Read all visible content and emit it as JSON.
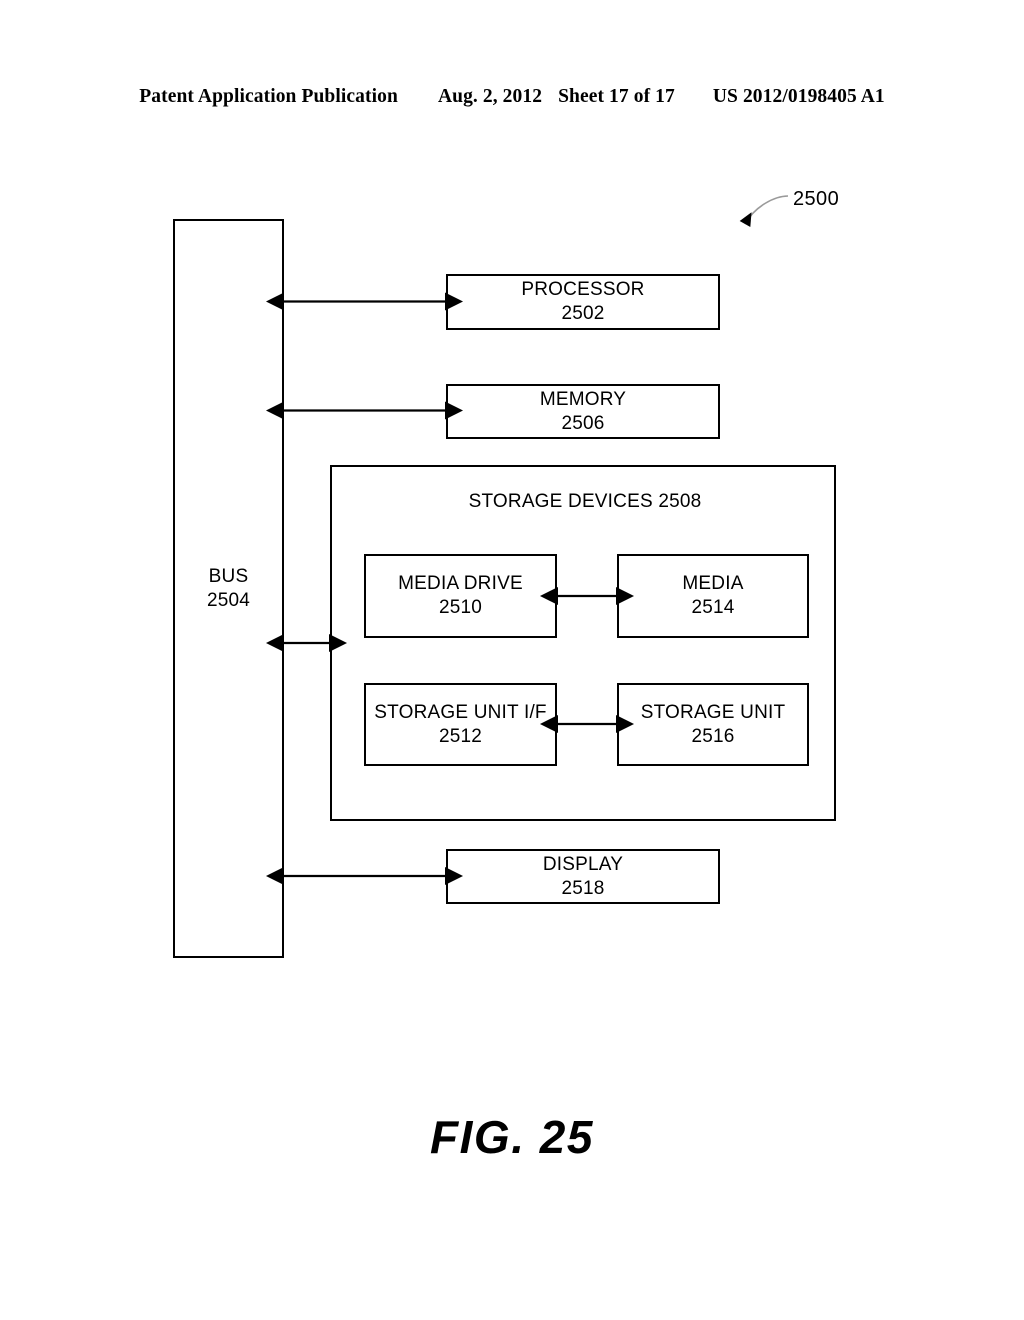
{
  "header": {
    "publication": "Patent Application Publication",
    "date": "Aug. 2, 2012",
    "sheet": "Sheet 17 of 17",
    "doc_number": "US 2012/0198405 A1"
  },
  "figure": {
    "caption": "FIG. 25",
    "system_ref": "2500"
  },
  "blocks": {
    "bus": {
      "label": "BUS",
      "num": "2504"
    },
    "processor": {
      "label": "PROCESSOR",
      "num": "2502"
    },
    "memory": {
      "label": "MEMORY",
      "num": "2506"
    },
    "storage_devices": {
      "label": "STORAGE DEVICES",
      "num": "2508"
    },
    "media_drive": {
      "label": "MEDIA DRIVE",
      "num": "2510"
    },
    "media": {
      "label": "MEDIA",
      "num": "2514"
    },
    "storage_unit_if": {
      "label": "STORAGE UNIT I/F",
      "num": "2512"
    },
    "storage_unit": {
      "label": "STORAGE UNIT",
      "num": "2516"
    },
    "display": {
      "label": "DISPLAY",
      "num": "2518"
    }
  },
  "connections": [
    {
      "name": "bus-to-processor",
      "from": "bus",
      "to": "processor",
      "style": "double-arrow"
    },
    {
      "name": "bus-to-memory",
      "from": "bus",
      "to": "memory",
      "style": "double-arrow"
    },
    {
      "name": "bus-to-storage-devices",
      "from": "bus",
      "to": "storage_devices",
      "style": "double-arrow"
    },
    {
      "name": "bus-to-display",
      "from": "bus",
      "to": "display",
      "style": "double-arrow"
    },
    {
      "name": "media-drive-to-media",
      "from": "media_drive",
      "to": "media",
      "style": "double-arrow"
    },
    {
      "name": "storage-unit-if-to-storage-unit",
      "from": "storage_unit_if",
      "to": "storage_unit",
      "style": "double-arrow"
    }
  ],
  "colors": {
    "ink": "#000000",
    "paper": "#ffffff",
    "leader": "#808080"
  }
}
